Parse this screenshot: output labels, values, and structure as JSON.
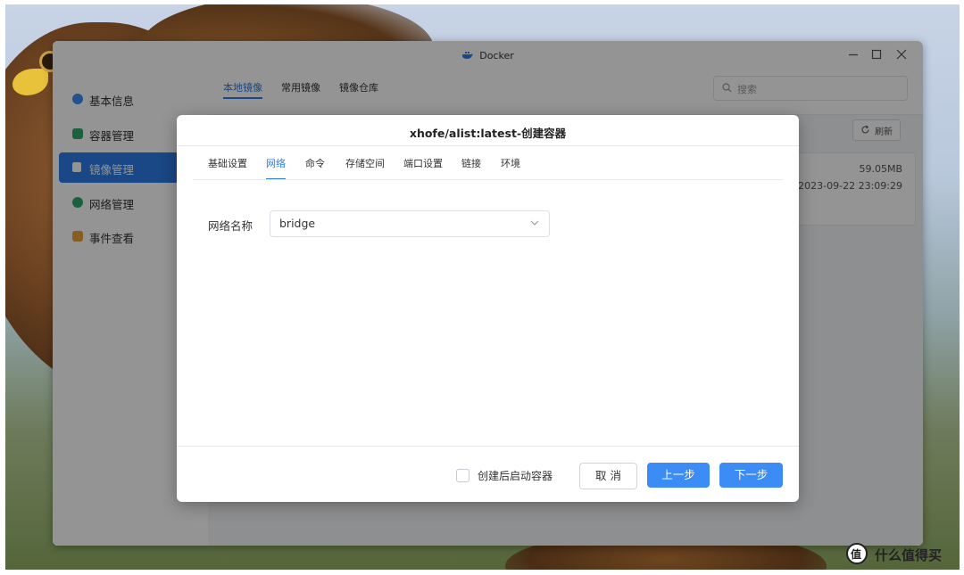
{
  "window": {
    "title": "Docker"
  },
  "sidebar": {
    "items": [
      {
        "label": "基本信息",
        "icon": "docker-whale-icon",
        "color": "#3b8cf5"
      },
      {
        "label": "容器管理",
        "icon": "cube-icon",
        "color": "#2fa86b"
      },
      {
        "label": "镜像管理",
        "icon": "image-layers-icon",
        "color": "#ffffff"
      },
      {
        "label": "网络管理",
        "icon": "globe-icon",
        "color": "#2fa86b"
      },
      {
        "label": "事件查看",
        "icon": "calendar-icon",
        "color": "#e8a33a"
      }
    ],
    "active_index": 2
  },
  "main": {
    "tabs": [
      {
        "label": "本地镜像",
        "active": true
      },
      {
        "label": "常用镜像",
        "active": false
      },
      {
        "label": "镜像仓库",
        "active": false
      }
    ],
    "search_placeholder": "搜索",
    "refresh_label": "刷新",
    "image_card": {
      "size": "59.05MB",
      "date": "2023-09-22 23:09:29"
    }
  },
  "dialog": {
    "title": "xhofe/alist:latest-创建容器",
    "tabs": [
      {
        "label": "基础设置",
        "active": false
      },
      {
        "label": "网络",
        "active": true
      },
      {
        "label": "命令",
        "active": false
      },
      {
        "label": "存储空间",
        "active": false
      },
      {
        "label": "端口设置",
        "active": false
      },
      {
        "label": "链接",
        "active": false
      },
      {
        "label": "环境",
        "active": false
      }
    ],
    "network_label": "网络名称",
    "network_value": "bridge",
    "start_after_create_label": "创建后启动容器",
    "start_after_create_checked": false,
    "cancel_label": "取 消",
    "prev_label": "上一步",
    "next_label": "下一步"
  },
  "watermark": {
    "text": "什么值得买"
  },
  "colors": {
    "accent": "#2d7be5",
    "button": "#3b8cf5"
  }
}
